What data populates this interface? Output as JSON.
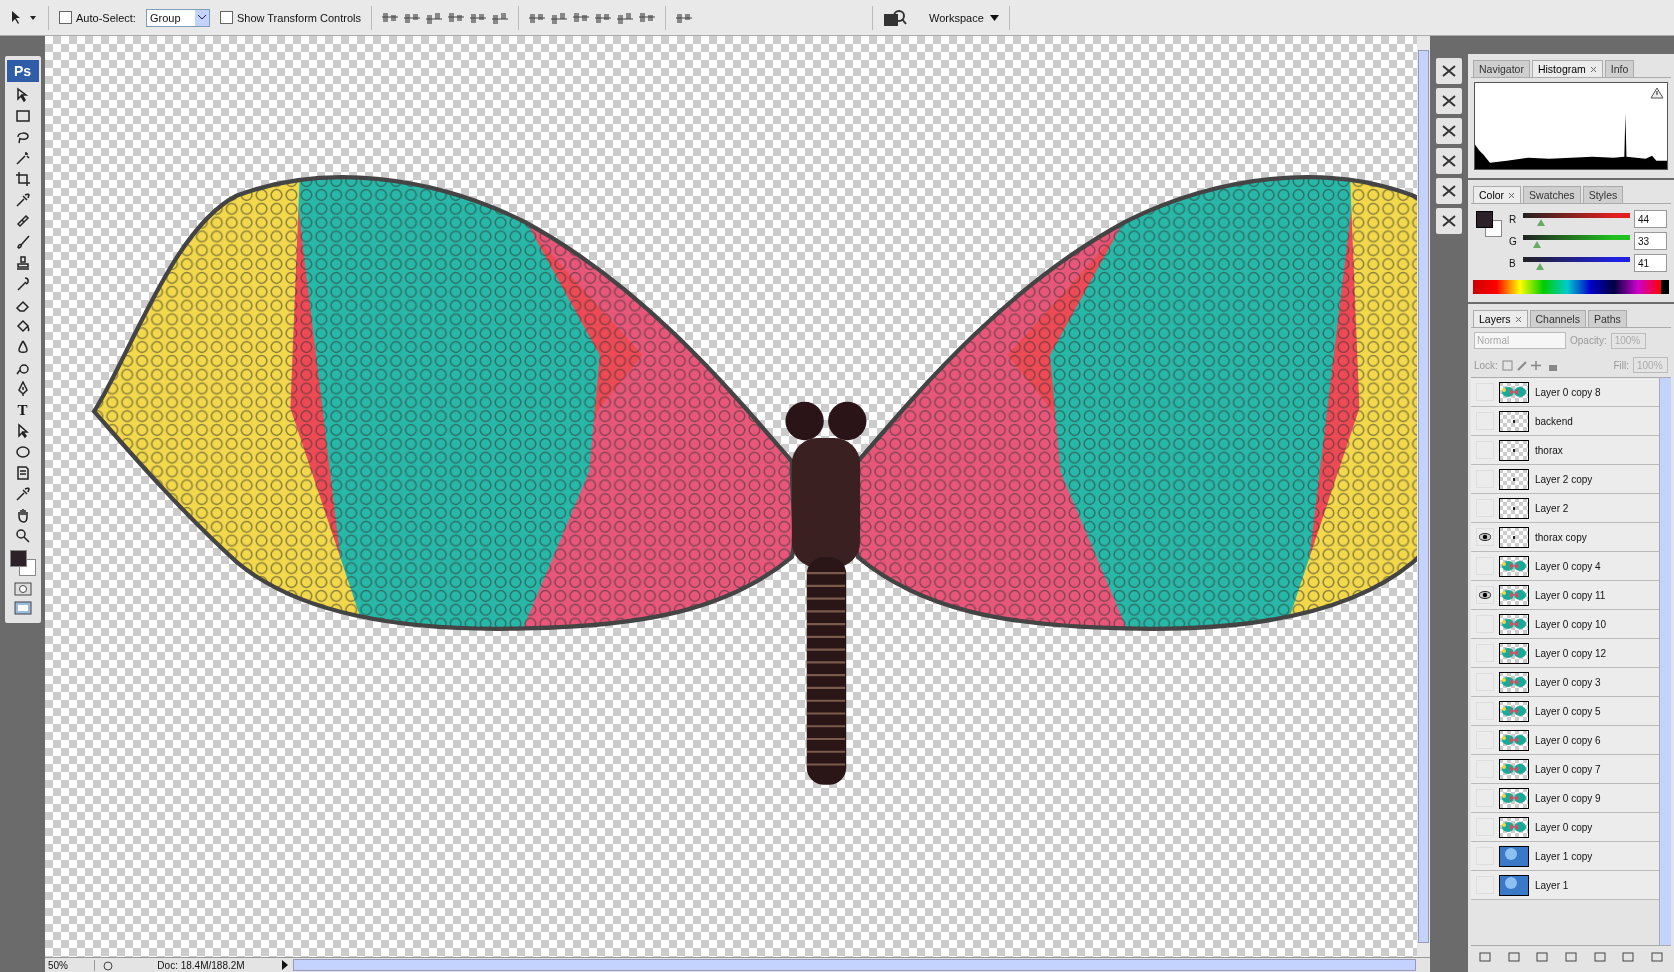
{
  "options_bar": {
    "auto_select": {
      "label": "Auto-Select:",
      "checked": false
    },
    "auto_select_mode": "Group",
    "show_transform_controls": {
      "label": "Show Transform Controls",
      "checked": false
    },
    "workspace": "Workspace"
  },
  "toolbox": {
    "logo": "Ps",
    "text_tool": "T"
  },
  "histogram_panel": {
    "tabs": [
      {
        "label": "Navigator",
        "selected": false
      },
      {
        "label": "Histogram",
        "selected": true
      },
      {
        "label": "Info",
        "selected": false
      }
    ]
  },
  "color_panel": {
    "tabs": [
      {
        "label": "Color",
        "selected": true
      },
      {
        "label": "Swatches",
        "selected": false
      },
      {
        "label": "Styles",
        "selected": false
      }
    ],
    "channels": [
      {
        "name": "R",
        "value": "44",
        "level": 0.17,
        "color": "#e02020"
      },
      {
        "name": "G",
        "value": "33",
        "level": 0.13,
        "color": "#20c020"
      },
      {
        "name": "B",
        "value": "41",
        "level": 0.16,
        "color": "#2020e0"
      }
    ]
  },
  "layers_panel": {
    "tabs": [
      {
        "label": "Layers",
        "selected": true
      },
      {
        "label": "Channels",
        "selected": false
      },
      {
        "label": "Paths",
        "selected": false
      }
    ],
    "blend_mode": {
      "value": "Normal",
      "disabled": true
    },
    "opacity_label": "Opacity:",
    "opacity": "100%",
    "lock_label": "Lock:",
    "fill_label": "Fill:",
    "fill": "100%",
    "layers": [
      {
        "name": "Layer 0 copy 8",
        "visible": false,
        "kind": "wings"
      },
      {
        "name": "backend",
        "visible": false,
        "kind": "transparent"
      },
      {
        "name": "thorax",
        "visible": false,
        "kind": "transparent"
      },
      {
        "name": "Layer 2 copy",
        "visible": false,
        "kind": "transparent"
      },
      {
        "name": "Layer 2",
        "visible": false,
        "kind": "transparent"
      },
      {
        "name": "thorax copy",
        "visible": true,
        "kind": "transparent"
      },
      {
        "name": "Layer 0 copy 4",
        "visible": false,
        "kind": "wings"
      },
      {
        "name": "Layer 0 copy 11",
        "visible": true,
        "kind": "wings"
      },
      {
        "name": "Layer 0 copy 10",
        "visible": false,
        "kind": "wings"
      },
      {
        "name": "Layer 0 copy 12",
        "visible": false,
        "kind": "wings"
      },
      {
        "name": "Layer 0 copy 3",
        "visible": false,
        "kind": "wings"
      },
      {
        "name": "Layer 0 copy 5",
        "visible": false,
        "kind": "wings"
      },
      {
        "name": "Layer 0 copy 6",
        "visible": false,
        "kind": "wings"
      },
      {
        "name": "Layer 0 copy 7",
        "visible": false,
        "kind": "wings"
      },
      {
        "name": "Layer 0 copy 9",
        "visible": false,
        "kind": "wings"
      },
      {
        "name": "Layer 0 copy",
        "visible": false,
        "kind": "wings"
      },
      {
        "name": "Layer 1 copy",
        "visible": false,
        "kind": "texture"
      },
      {
        "name": "Layer 1",
        "visible": false,
        "kind": "texture"
      }
    ]
  },
  "status_bar": {
    "zoom": "50%",
    "doc_info": "Doc: 18.4M/188.2M"
  }
}
